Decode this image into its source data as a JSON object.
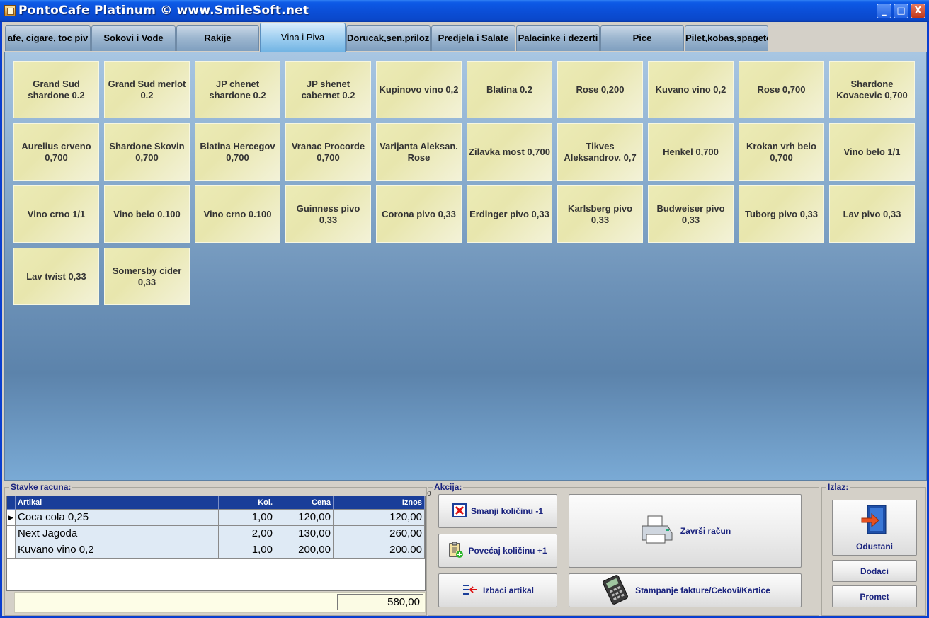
{
  "window": {
    "title": "PontoCafe Platinum © www.SmileSoft.net",
    "minimize": "_",
    "maximize": "□",
    "close": "X"
  },
  "tabs": [
    {
      "label": "afe, cigare, toc piv",
      "active": false
    },
    {
      "label": "Sokovi i Vode",
      "active": false
    },
    {
      "label": "Rakije",
      "active": false
    },
    {
      "label": "Vina i Piva",
      "active": true
    },
    {
      "label": "Dorucak,sen.prilozi",
      "active": false
    },
    {
      "label": "Predjela i Salate",
      "active": false
    },
    {
      "label": "Palacinke i dezerti",
      "active": false
    },
    {
      "label": "Pice",
      "active": false
    },
    {
      "label": "Pilet,kobas,spagete",
      "active": false
    }
  ],
  "products": [
    [
      "Grand Sud shardone 0.2",
      "Grand Sud merlot 0.2",
      "JP chenet shardone 0.2",
      "JP shenet cabernet 0.2",
      "Kupinovo vino 0,2",
      "Blatina 0.2",
      "Rose 0,200",
      "Kuvano vino 0,2",
      "Rose 0,700",
      "Shardone Kovacevic 0,700"
    ],
    [
      "Aurelius crveno 0,700",
      "Shardone Skovin 0,700",
      "Blatina Hercegov 0,700",
      "Vranac Procorde 0,700",
      "Varijanta Aleksan. Rose",
      "Zilavka most 0,700",
      "Tikves Aleksandrov. 0,7",
      "Henkel 0,700",
      "Krokan vrh belo 0,700",
      "Vino belo 1/1"
    ],
    [
      "Vino crno 1/1",
      "Vino belo 0.100",
      "Vino crno 0.100",
      "Guinness pivo 0,33",
      "Corona pivo 0,33",
      "Erdinger pivo 0,33",
      "Karlsberg pivo 0,33",
      "Budweiser pivo 0,33",
      "Tuborg pivo 0,33",
      "Lav pivo  0,33"
    ],
    [
      "Lav twist 0,33",
      "Somersby cider 0,33"
    ]
  ],
  "bill": {
    "label": "Stavke racuna:",
    "columns": [
      "Artikal",
      "Kol.",
      "Cena",
      "Iznos"
    ],
    "rows": [
      {
        "artikal": "Coca cola 0,25",
        "kol": "1,00",
        "cena": "120,00",
        "iznos": "120,00",
        "current": true
      },
      {
        "artikal": "Next Jagoda",
        "kol": "2,00",
        "cena": "130,00",
        "iznos": "260,00",
        "current": false
      },
      {
        "artikal": "Kuvano vino 0,2",
        "kol": "1,00",
        "cena": "200,00",
        "iznos": "200,00",
        "current": false
      }
    ],
    "total": "580,00"
  },
  "actions": {
    "label": "Akcija:",
    "zero_mark": "0",
    "decrease": "Smanji količinu -1",
    "increase": "Povećaj količinu +1",
    "remove": "Izbaci artikal",
    "finish": "Završi račun",
    "print": "Stampanje fakture/Cekovi/Kartice"
  },
  "exit": {
    "label": "Izlaz:",
    "cancel": "Odustani",
    "extras": "Dodaci",
    "turnover": "Promet"
  },
  "colors": {
    "title_bar": "#0b4fd8",
    "product_tile": "#ecebb6",
    "grid_header": "#1a3e99",
    "button_text": "#1a237e"
  }
}
